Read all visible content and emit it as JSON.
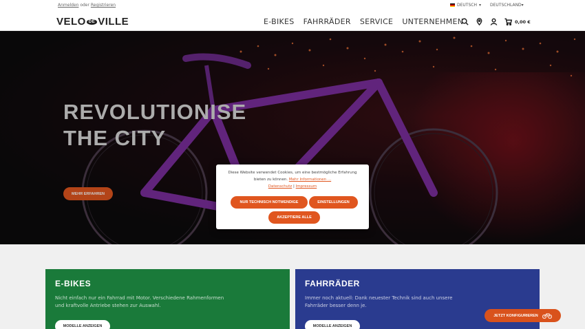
{
  "topbar": {
    "login": "Anmelden",
    "or": " oder ",
    "register": "Registrieren",
    "language": "DEUTSCH",
    "country": "DEUTSCHLAND"
  },
  "header": {
    "logo_left": "VELO",
    "logo_mid": "DE",
    "logo_right": "VILLE",
    "nav": [
      "E-BIKES",
      "FAHRRÄDER",
      "SERVICE",
      "UNTERNEHMEN"
    ],
    "cart_total": "0,00 €"
  },
  "hero": {
    "title_line1": "REVOLUTIONISE",
    "title_line2": "THE CITY",
    "cta_label": "MEHR ERFAHREN"
  },
  "cookie": {
    "text": "Diese Website verwendet Cookies, um eine bestmögliche Erfahrung bieten zu können.",
    "more_info": "Mehr Informationen ...",
    "privacy": "Datenschutz",
    "separator": "|",
    "imprint": "Impressum",
    "btn_necessary": "NUR TECHNISCH NOTWENDIGE",
    "btn_settings": "EINSTELLUNGEN",
    "btn_accept": "AKZEPTIERE ALLE"
  },
  "cards": [
    {
      "title": "E-BIKES",
      "description": "Nicht einfach nur ein Fahrrad mit Motor. Verschiedene Rahmenformen und kraftvolle Antriebe stehen zur Auswahl.",
      "button": "MODELLE ANZEIGEN"
    },
    {
      "title": "FAHRRÄDER",
      "description": "Immer noch aktuell: Dank neuester Technik sind auch unsere Fahrräder besser denn je.",
      "button": "MODELLE ANZEIGEN"
    }
  ],
  "configure_label": "JETZT KONFIGURIEREN",
  "colors": {
    "accent": "#e0561f",
    "ebikes_card": "#1a7a3a",
    "bikes_card": "#2a3b8f",
    "hero_bg": "#0c0a0c"
  },
  "icons": [
    "search-icon",
    "location-icon",
    "user-icon",
    "cart-icon",
    "bike-icon",
    "flag-de-icon"
  ]
}
